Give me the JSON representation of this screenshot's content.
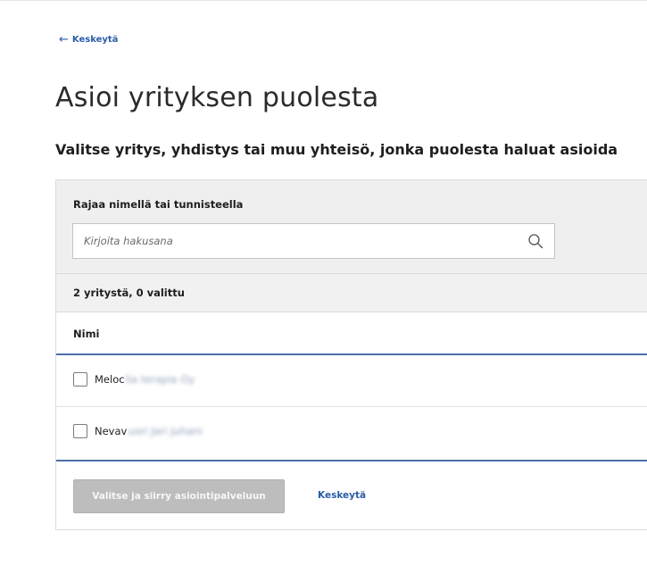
{
  "nav": {
    "back_label": "Keskeytä"
  },
  "page": {
    "title": "Asioi yrityksen puolesta",
    "subtitle": "Valitse yritys, yhdistys tai muu yhteisö, jonka puolesta haluat asioida"
  },
  "filter": {
    "label": "Rajaa nimellä tai tunnisteella",
    "placeholder": "Kirjoita hakusana",
    "value": ""
  },
  "results": {
    "count_text": "2 yritystä, 0 valittu"
  },
  "table": {
    "header_name": "Nimi",
    "rows": [
      {
        "name_visible": "Meloc",
        "name_blurred": "lia terapia Oy",
        "checked": false
      },
      {
        "name_visible": "Nevav",
        "name_blurred": "uori Jari Juhani",
        "checked": false
      }
    ]
  },
  "actions": {
    "primary_label": "Valitse ja siirry asiointipalveluun",
    "cancel_label": "Keskeytä"
  },
  "colors": {
    "link": "#2a5ca8",
    "accent_line": "#4a6fa8",
    "disabled_button": "#bdbdbd",
    "panel_bg": "#efefef"
  }
}
